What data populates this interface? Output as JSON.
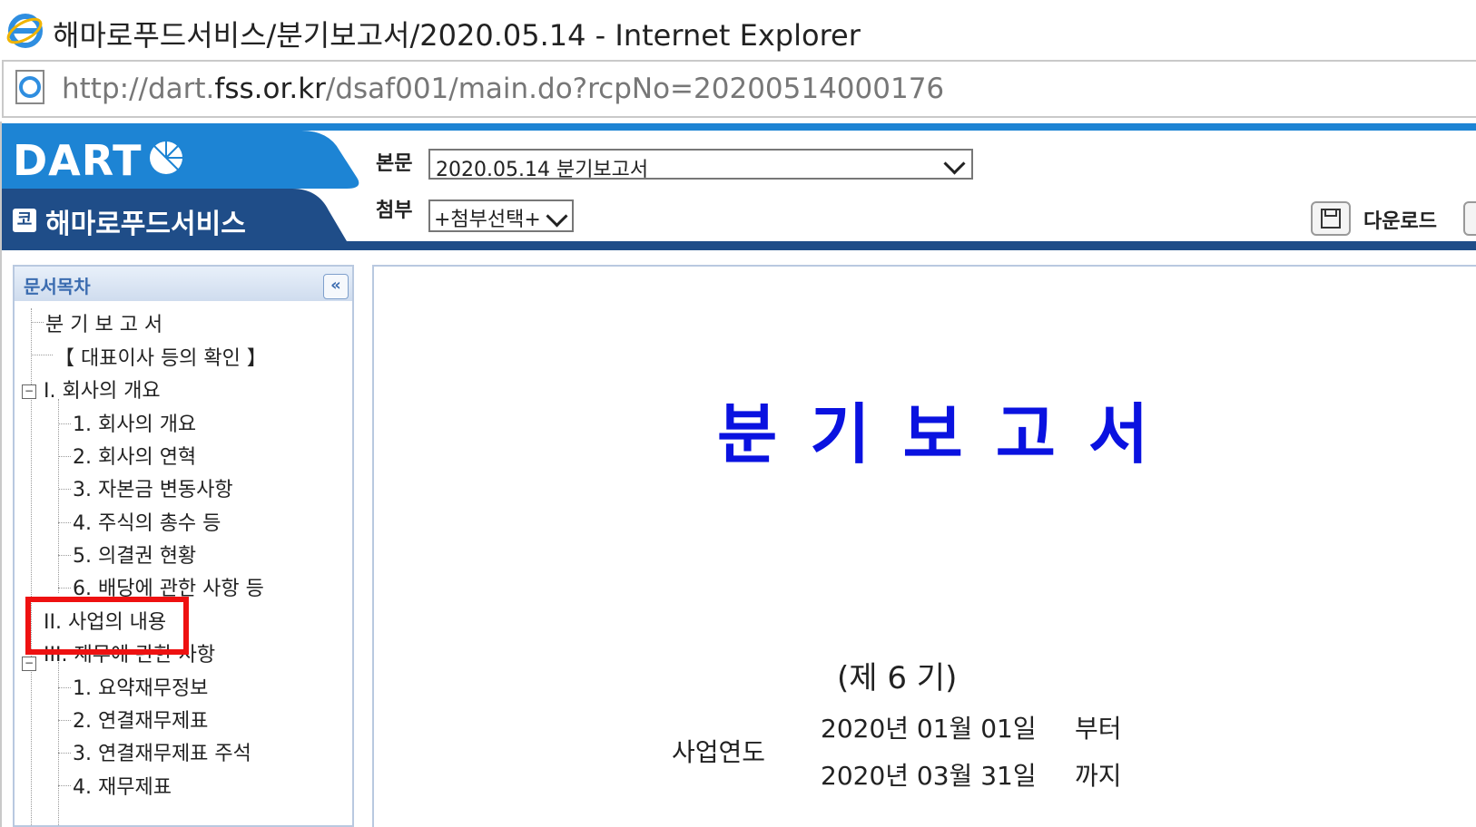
{
  "window": {
    "title": "해마로푸드서비스/분기보고서/2020.05.14 - Internet Explorer",
    "url_prefix": "http://dart.",
    "url_domain": "fss.or.kr",
    "url_path": "/dsaf001/main.do?rcpNo=20200514000176"
  },
  "header": {
    "logo": "DART",
    "company_icon": "코",
    "company_name": "해마로푸드서비스",
    "main_label": "본문",
    "main_select": "2020.05.14  분기보고서",
    "attach_label": "첨부",
    "attach_select": "+첨부선택+",
    "download_label": "다운로드"
  },
  "sidebar": {
    "title": "문서목차",
    "collapse": "«",
    "items": [
      "분 기 보 고 서",
      "【 대표이사 등의 확인 】",
      "I. 회사의 개요",
      "1. 회사의 개요",
      "2. 회사의 연혁",
      "3. 자본금 변동사항",
      "4. 주식의 총수 등",
      "5. 의결권 현황",
      "6. 배당에 관한 사항 등",
      "II. 사업의 내용",
      "III. 재무에 관한 사항",
      "1. 요약재무정보",
      "2. 연결재무제표",
      "3. 연결재무제표 주석",
      "4. 재무제표"
    ]
  },
  "document": {
    "title": "분기보고서",
    "term": "(제 6 기)",
    "period_label": "사업연도",
    "date_from": "2020년 01월 01일",
    "date_to": "2020년 03월 31일",
    "from_word": "부터",
    "to_word": "까지"
  },
  "colors": {
    "dart_blue": "#1d84d4",
    "dart_navy": "#1f4d88",
    "title_blue": "#0a12e0",
    "highlight_red": "#ee1111"
  }
}
